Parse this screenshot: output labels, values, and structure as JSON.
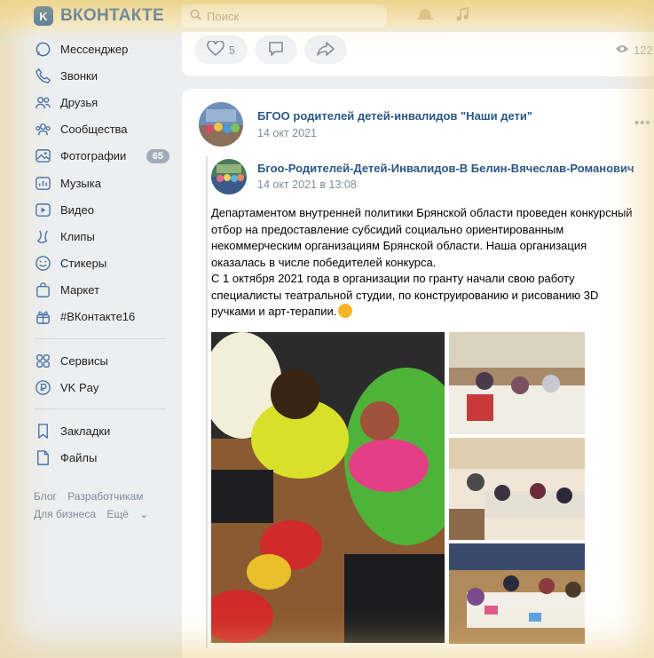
{
  "topbar": {
    "logo_letter": "K",
    "logo_text": "ВКОНТАКТЕ",
    "search_placeholder": "Поиск"
  },
  "sidebar": {
    "items": [
      {
        "label": "Мессенджер",
        "icon": "messenger-icon"
      },
      {
        "label": "Звонки",
        "icon": "phone-icon"
      },
      {
        "label": "Друзья",
        "icon": "friends-icon"
      },
      {
        "label": "Сообщества",
        "icon": "communities-icon"
      },
      {
        "label": "Фотографии",
        "icon": "photos-icon",
        "badge": "65"
      },
      {
        "label": "Музыка",
        "icon": "music-icon"
      },
      {
        "label": "Видео",
        "icon": "video-icon"
      },
      {
        "label": "Клипы",
        "icon": "clips-icon"
      },
      {
        "label": "Стикеры",
        "icon": "stickers-icon"
      },
      {
        "label": "Маркет",
        "icon": "market-icon"
      },
      {
        "label": "#ВКонтакте16",
        "icon": "gift-icon"
      }
    ],
    "items2": [
      {
        "label": "Сервисы",
        "icon": "services-icon"
      },
      {
        "label": "VK Pay",
        "icon": "vkpay-icon"
      }
    ],
    "items3": [
      {
        "label": "Закладки",
        "icon": "bookmark-icon"
      },
      {
        "label": "Файлы",
        "icon": "files-icon"
      }
    ],
    "footer": {
      "blog": "Блог",
      "developers": "Разработчикам",
      "business": "Для бизнеса",
      "more": "Ещё"
    }
  },
  "prev_post": {
    "likes": "5",
    "views": "122"
  },
  "post": {
    "author": "БГОО родителей детей-инвалидов \"Наши дети\"",
    "date": "14 окт 2021",
    "repost_author": "Бгоо-Родителей-Детей-Инвалидов-В Белин-Вячеслав-Романович",
    "repost_date": "14 окт 2021 в 13:08",
    "text": "Департаментом внутренней политики Брянской области проведен конкурсный\nотбор на предоставление субсидий социально ориентированным\nнекоммерческим организациям Брянской области. Наша организация\nоказалась в числе победителей конкурса.\nС 1 октября 2021 года в организации по гранту начали свою работу\nспециалисты театральной студии, по конструированию и рисованию 3D\nручками и арт-терапии."
  },
  "colors": {
    "accent": "#4a76a8",
    "link": "#2a5885",
    "secondary": "#818c99",
    "badge": "#a0abb8"
  }
}
